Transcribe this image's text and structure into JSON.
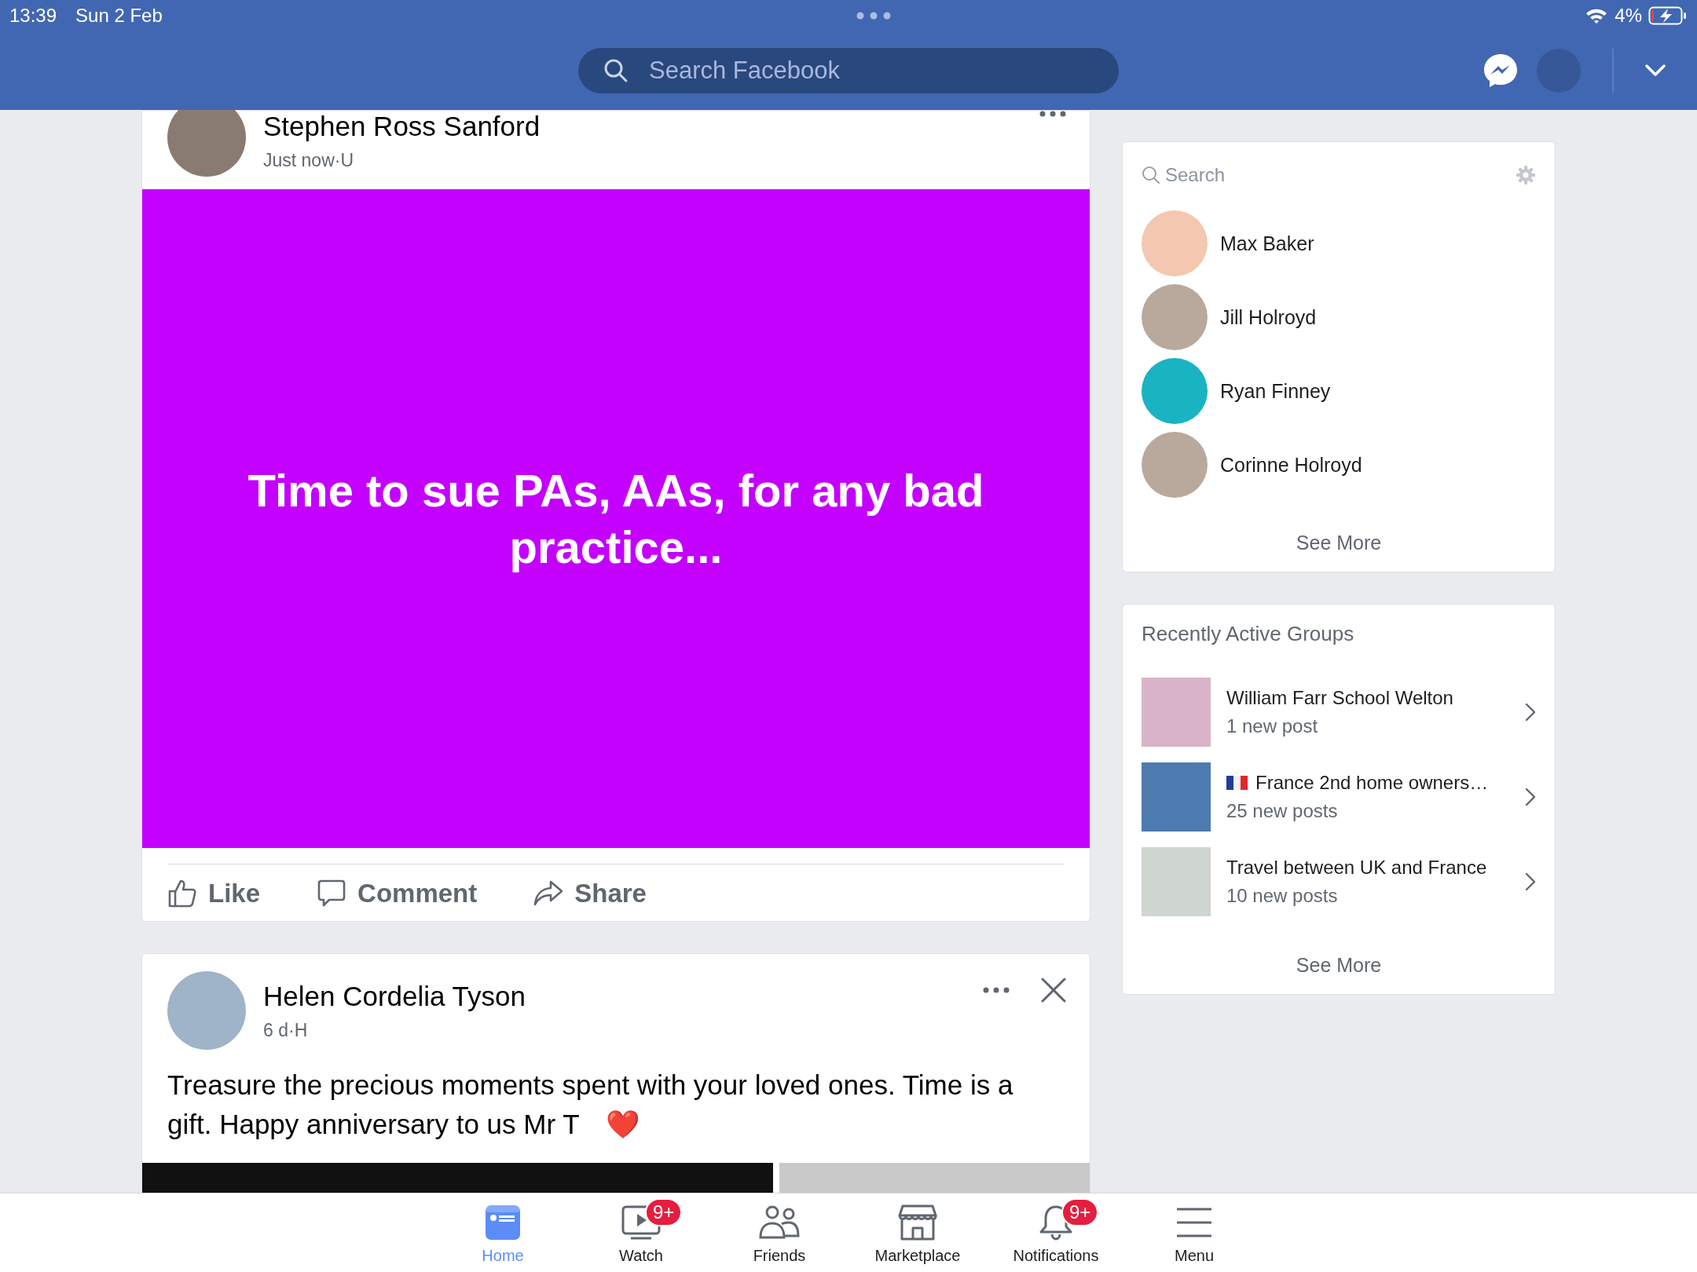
{
  "status_bar": {
    "time": "13:39",
    "date": "Sun 2 Feb",
    "battery": "4%"
  },
  "header": {
    "search": {
      "placeholder": "Search Facebook"
    }
  },
  "posts": [
    {
      "kind": "text_background",
      "author": "Stephen Ross Sanford",
      "meta": "Just now·U",
      "text": "Time to sue PAs, AAs, for any bad practice...",
      "closable": false,
      "actions": [
        "Like",
        "Comment",
        "Share"
      ]
    },
    {
      "kind": "photo",
      "author": "Helen Cordelia Tyson",
      "meta": "6 d·H",
      "text": "Treasure the precious moments spent with your loved ones. Time is a gift. Happy anniversary to us Mr T",
      "emoji": "❤️",
      "closable": true
    }
  ],
  "contacts": {
    "search": {
      "placeholder": "Search"
    },
    "people": [
      "Max Baker",
      "Jill Holroyd",
      "Ryan Finney",
      "Corinne Holroyd"
    ],
    "see_more": "See More"
  },
  "groups": {
    "title": "Recently Active Groups",
    "items": [
      {
        "name": "William Farr School Welton",
        "subtitle": "1 new post",
        "flag": false
      },
      {
        "name": "France 2nd home owners…",
        "subtitle": "25 new posts",
        "flag": true
      },
      {
        "name": "Travel between UK and France",
        "subtitle": "10 new posts",
        "flag": false
      }
    ],
    "see_more": "See More"
  },
  "bottom_nav": [
    {
      "kind": "home",
      "label": "Home",
      "selected": true
    },
    {
      "kind": "watch",
      "label": "Watch",
      "selected": false,
      "badge": "9+"
    },
    {
      "kind": "friends",
      "label": "Friends",
      "selected": false
    },
    {
      "kind": "marketplace",
      "label": "Marketplace",
      "selected": false
    },
    {
      "kind": "notifications",
      "label": "Notifications",
      "selected": false,
      "badge": "9+"
    },
    {
      "kind": "menu",
      "label": "Menu",
      "selected": false
    }
  ]
}
